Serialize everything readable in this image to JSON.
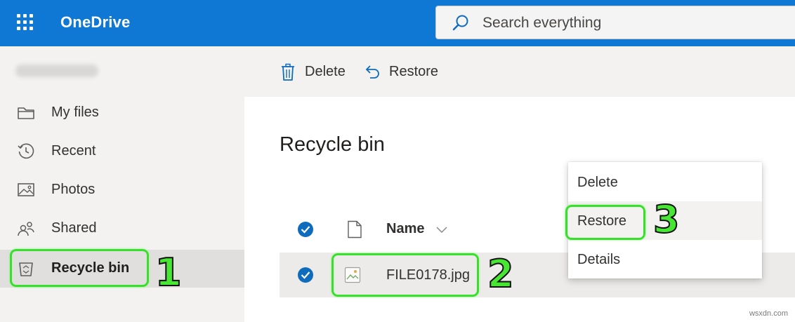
{
  "app": {
    "name": "OneDrive"
  },
  "search": {
    "placeholder": "Search everything"
  },
  "sidebar": {
    "items": [
      {
        "label": "My files",
        "icon": "folder-icon"
      },
      {
        "label": "Recent",
        "icon": "history-icon"
      },
      {
        "label": "Photos",
        "icon": "photo-icon"
      },
      {
        "label": "Shared",
        "icon": "people-icon"
      },
      {
        "label": "Recycle bin",
        "icon": "recycle-bin-icon",
        "selected": true
      }
    ]
  },
  "command_bar": {
    "delete_label": "Delete",
    "restore_label": "Restore"
  },
  "main": {
    "title": "Recycle bin",
    "columns": {
      "name": "Name"
    },
    "files": [
      {
        "name": "FILE0178.jpg",
        "selected": true,
        "icon": "image-file-icon"
      }
    ]
  },
  "context_menu": {
    "items": [
      {
        "label": "Delete"
      },
      {
        "label": "Restore",
        "highlighted": true
      },
      {
        "label": "Details"
      }
    ]
  },
  "annotations": {
    "step1": "1",
    "step2": "2",
    "step3": "3"
  },
  "watermark": "wsxdn.com",
  "colors": {
    "brand_blue": "#0f78d4",
    "check_blue": "#0f6cbd",
    "annotation_green": "#37e12b"
  }
}
